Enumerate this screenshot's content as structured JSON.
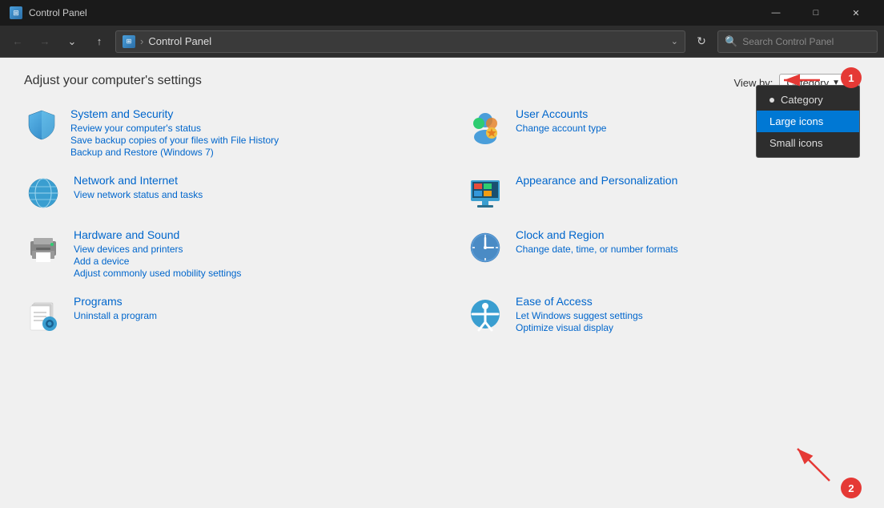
{
  "titleBar": {
    "icon": "⊞",
    "title": "Control Panel",
    "minBtn": "—",
    "maxBtn": "□",
    "closeBtn": "✕"
  },
  "addressBar": {
    "backBtn": "←",
    "forwardBtn": "→",
    "dropdownBtn": "∨",
    "upBtn": "↑",
    "pathIcon": "⊞",
    "pathSeparator": "›",
    "pathText": "Control Panel",
    "refreshBtn": "↻",
    "searchPlaceholder": "Search Control Panel",
    "searchIcon": "🔍"
  },
  "main": {
    "title": "Adjust your computer's settings",
    "viewByLabel": "View by:",
    "viewByValue": "Category",
    "dropdownArrow": "▼"
  },
  "dropdownMenu": {
    "items": [
      {
        "label": "Category",
        "active": false,
        "hasDot": true
      },
      {
        "label": "Large icons",
        "active": true,
        "hasDot": false
      },
      {
        "label": "Small icons",
        "active": false,
        "hasDot": false
      }
    ]
  },
  "categories": [
    {
      "id": "system",
      "title": "System and Security",
      "links": [
        "Review your computer's status",
        "Save backup copies of your files with File History",
        "Backup and Restore (Windows 7)"
      ]
    },
    {
      "id": "user",
      "title": "User Accounts",
      "links": [
        "Change account type"
      ]
    },
    {
      "id": "network",
      "title": "Network and Internet",
      "links": [
        "View network status and tasks"
      ]
    },
    {
      "id": "appearance",
      "title": "Appearance and Personalization",
      "links": []
    },
    {
      "id": "hardware",
      "title": "Hardware and Sound",
      "links": [
        "View devices and printers",
        "Add a device",
        "Adjust commonly used mobility settings"
      ]
    },
    {
      "id": "clock",
      "title": "Clock and Region",
      "links": [
        "Change date, time, or number formats"
      ]
    },
    {
      "id": "programs",
      "title": "Programs",
      "links": [
        "Uninstall a program"
      ]
    },
    {
      "id": "ease",
      "title": "Ease of Access",
      "links": [
        "Let Windows suggest settings",
        "Optimize visual display"
      ]
    }
  ],
  "badges": {
    "badge1": "1",
    "badge2": "2"
  }
}
